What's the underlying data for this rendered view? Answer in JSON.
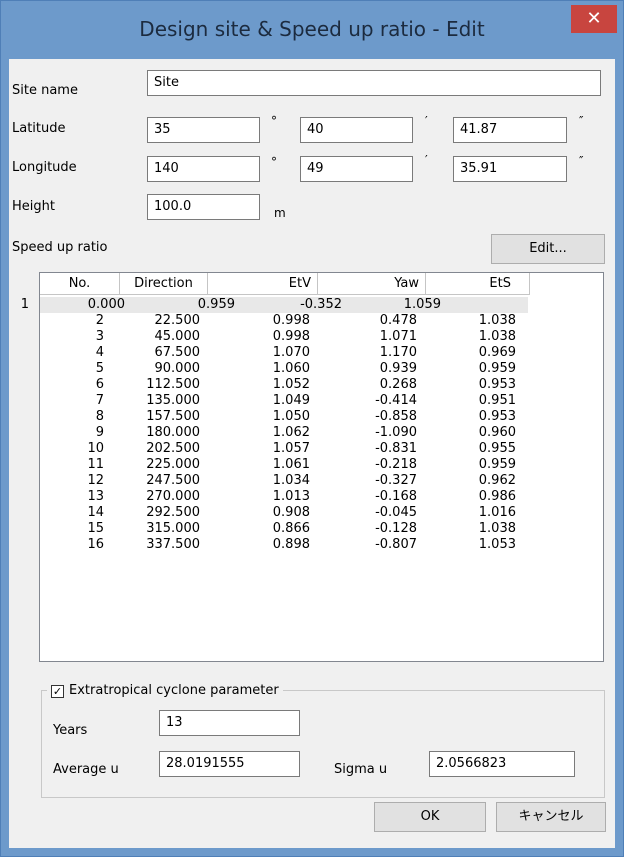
{
  "window": {
    "title": "Design site & Speed up ratio - Edit",
    "close_glyph": "✕"
  },
  "site": {
    "name_label": "Site name",
    "name_value": "Site",
    "latitude_label": "Latitude",
    "latitude": {
      "deg": "35",
      "min": "40",
      "sec": "41.87"
    },
    "longitude_label": "Longitude",
    "longitude": {
      "deg": "140",
      "min": "49",
      "sec": "35.91"
    },
    "height_label": "Height",
    "height_value": "100.0",
    "height_unit": "m",
    "deg_symbol": "°",
    "min_symbol": "′",
    "sec_symbol": "″"
  },
  "speed_up": {
    "label": "Speed up ratio",
    "edit_button": "Edit...",
    "columns": [
      "No.",
      "Direction",
      "EtV",
      "Yaw",
      "EtS"
    ],
    "rows": [
      [
        "1",
        "0.000",
        "0.959",
        "-0.352",
        "1.059"
      ],
      [
        "2",
        "22.500",
        "0.998",
        "0.478",
        "1.038"
      ],
      [
        "3",
        "45.000",
        "0.998",
        "1.071",
        "1.038"
      ],
      [
        "4",
        "67.500",
        "1.070",
        "1.170",
        "0.969"
      ],
      [
        "5",
        "90.000",
        "1.060",
        "0.939",
        "0.959"
      ],
      [
        "6",
        "112.500",
        "1.052",
        "0.268",
        "0.953"
      ],
      [
        "7",
        "135.000",
        "1.049",
        "-0.414",
        "0.951"
      ],
      [
        "8",
        "157.500",
        "1.050",
        "-0.858",
        "0.953"
      ],
      [
        "9",
        "180.000",
        "1.062",
        "-1.090",
        "0.960"
      ],
      [
        "10",
        "202.500",
        "1.057",
        "-0.831",
        "0.955"
      ],
      [
        "11",
        "225.000",
        "1.061",
        "-0.218",
        "0.959"
      ],
      [
        "12",
        "247.500",
        "1.034",
        "-0.327",
        "0.962"
      ],
      [
        "13",
        "270.000",
        "1.013",
        "-0.168",
        "0.986"
      ],
      [
        "14",
        "292.500",
        "0.908",
        "-0.045",
        "1.016"
      ],
      [
        "15",
        "315.000",
        "0.866",
        "-0.128",
        "1.038"
      ],
      [
        "16",
        "337.500",
        "0.898",
        "-0.807",
        "1.053"
      ]
    ]
  },
  "cyclone": {
    "checkbox_label": "Extratropical cyclone parameter",
    "checked": true,
    "years_label": "Years",
    "years_value": "13",
    "average_label": "Average u",
    "average_value": "28.0191555",
    "sigma_label": "Sigma u",
    "sigma_value": "2.0566823"
  },
  "buttons": {
    "ok": "OK",
    "cancel": "キャンセル"
  }
}
